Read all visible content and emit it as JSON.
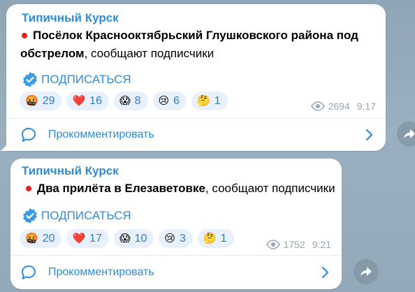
{
  "posts": [
    {
      "channel": "Типичный Курск",
      "text_bold": "Посёлок Красноoктябрьский Глушковского района под обстрелом",
      "text_rest": ", сообщают подписчики",
      "subscribe_label": "ПОДПИСАТЬСЯ",
      "reactions": [
        {
          "emoji": "🤬",
          "count": "29"
        },
        {
          "emoji": "❤️",
          "count": "16"
        },
        {
          "emoji": "😱",
          "count": "8"
        },
        {
          "emoji": "😢",
          "count": "6"
        },
        {
          "emoji": "🤔",
          "count": "1"
        }
      ],
      "views": "2694",
      "time": "9:17",
      "comment_label": "Прокомментировать"
    },
    {
      "channel": "Типичный Курск",
      "text_bold": "Два прилёта в Елезаветовке",
      "text_rest": ", сообщают подписчики",
      "subscribe_label": "ПОДПИСАТЬСЯ",
      "reactions": [
        {
          "emoji": "🤬",
          "count": "20"
        },
        {
          "emoji": "❤️",
          "count": "17"
        },
        {
          "emoji": "😱",
          "count": "10"
        },
        {
          "emoji": "😢",
          "count": "3"
        },
        {
          "emoji": "🤔",
          "count": "1"
        }
      ],
      "views": "1752",
      "time": "9:21",
      "comment_label": "Прокомментировать"
    }
  ],
  "colors": {
    "accent": "#2f8cd6",
    "dot": "#e02424",
    "reaction_bg": "#e8f1fb",
    "meta": "#9aa7b3"
  },
  "icons": [
    "verified-badge-icon",
    "eye-icon",
    "comment-icon",
    "chevron-right-icon",
    "share-arrow-icon"
  ]
}
